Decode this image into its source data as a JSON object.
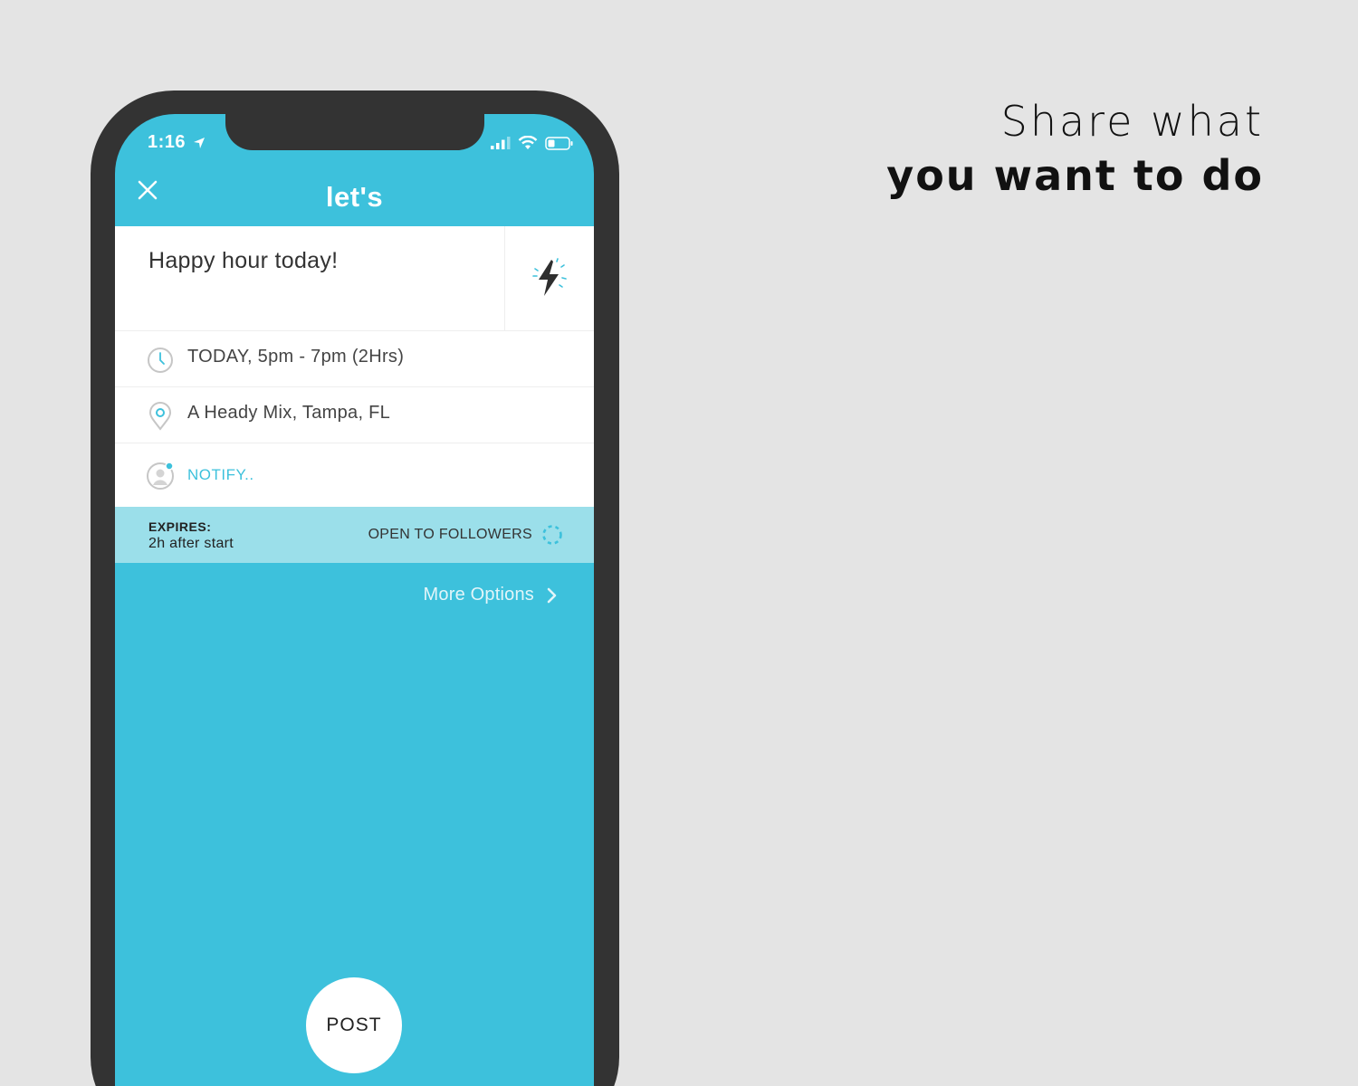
{
  "promo": {
    "line1": "Share what",
    "line2": "you want to do"
  },
  "status_bar": {
    "time": "1:16",
    "icons": [
      "location-arrow-icon",
      "signal-icon",
      "wifi-icon",
      "battery-icon"
    ]
  },
  "header": {
    "logo": "let's",
    "close_icon": "close-icon"
  },
  "form": {
    "title_value": "Happy hour today!",
    "boost_icon": "lightning-bolt-icon",
    "time_text": "TODAY, 5pm - 7pm (2Hrs)",
    "location_text": "A Heady Mix, Tampa, FL",
    "notify_text": "NOTIFY.."
  },
  "expiry": {
    "label": "EXPIRES:",
    "value": "2h after start",
    "audience": "OPEN TO FOLLOWERS"
  },
  "more_options": "More Options",
  "post_button": "POST",
  "colors": {
    "accent": "#3dc1dc",
    "band": "#9bdfea",
    "background": "#e4e4e4",
    "phone_frame": "#333333"
  }
}
